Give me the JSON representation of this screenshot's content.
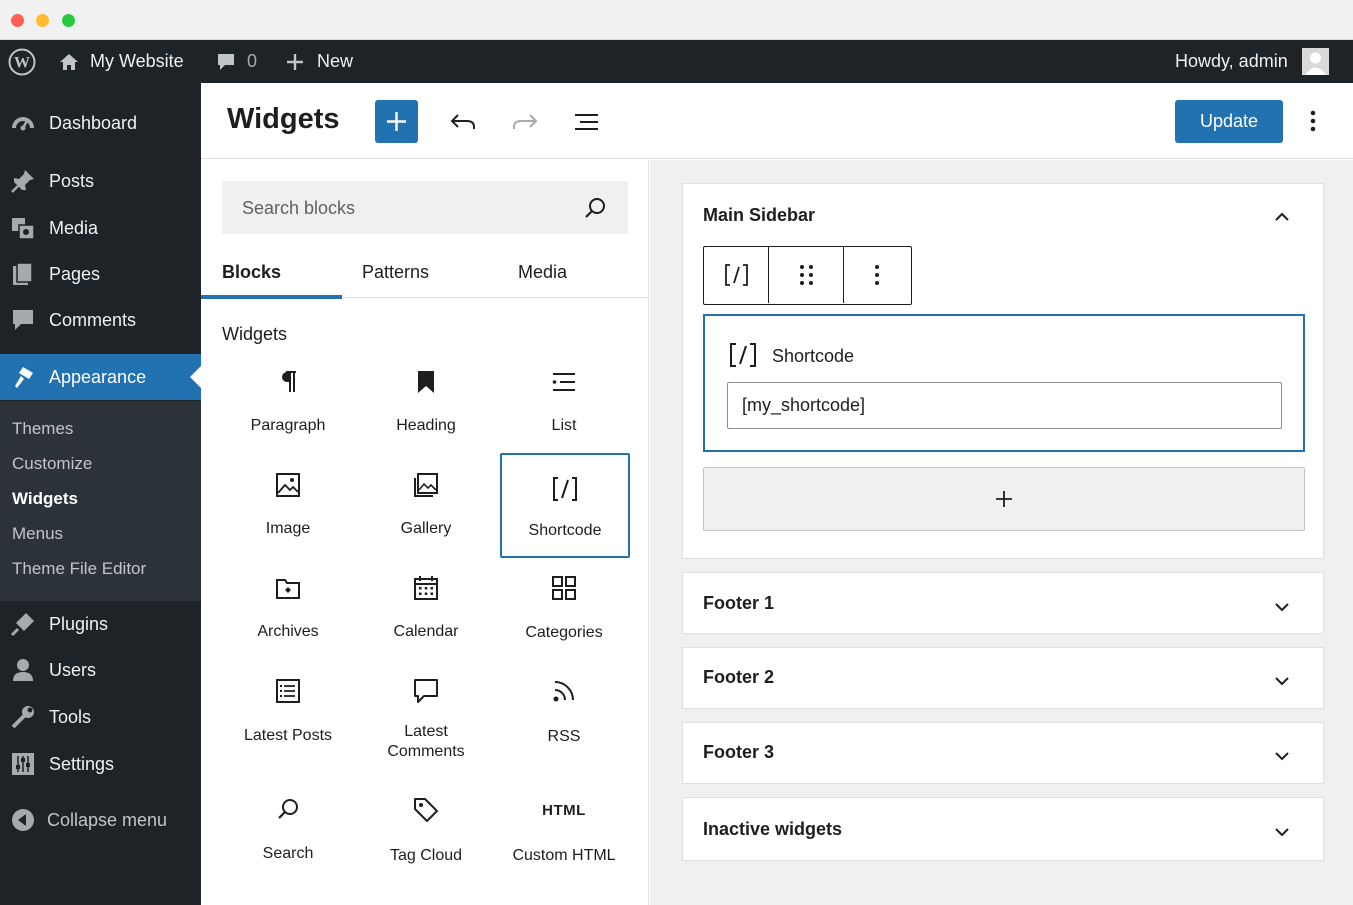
{
  "admin_bar": {
    "site_name": "My Website",
    "comments_count": "0",
    "new_label": "New",
    "howdy": "Howdy, admin"
  },
  "menu": {
    "dashboard": "Dashboard",
    "posts": "Posts",
    "media": "Media",
    "pages": "Pages",
    "comments": "Comments",
    "appearance": "Appearance",
    "submenu": [
      "Themes",
      "Customize",
      "Widgets",
      "Menus",
      "Theme File Editor"
    ],
    "plugins": "Plugins",
    "users": "Users",
    "tools": "Tools",
    "settings": "Settings",
    "collapse": "Collapse menu"
  },
  "header": {
    "title": "Widgets",
    "update_label": "Update"
  },
  "inserter": {
    "search_placeholder": "Search blocks",
    "tabs": [
      "Blocks",
      "Patterns",
      "Media"
    ],
    "section_title": "Widgets",
    "blocks": [
      "Paragraph",
      "Heading",
      "List",
      "Image",
      "Gallery",
      "Shortcode",
      "Archives",
      "Calendar",
      "Categories",
      "Latest Posts",
      "Latest Comments",
      "RSS",
      "Search",
      "Tag Cloud",
      "Custom HTML"
    ],
    "latest_comments_lines": [
      "Latest",
      "Comments"
    ],
    "html_icon_text": "HTML"
  },
  "widget_areas": {
    "main_sidebar": "Main Sidebar",
    "shortcode_block_label": "Shortcode",
    "shortcode_value": "[my_shortcode]",
    "shortcode_icon_text": "[/]",
    "footer1": "Footer 1",
    "footer2": "Footer 2",
    "footer3": "Footer 3",
    "inactive": "Inactive widgets"
  },
  "colors": {
    "accent": "#2271b1",
    "admin_dark": "#1d2327",
    "submenu_bg": "#2c3338"
  }
}
